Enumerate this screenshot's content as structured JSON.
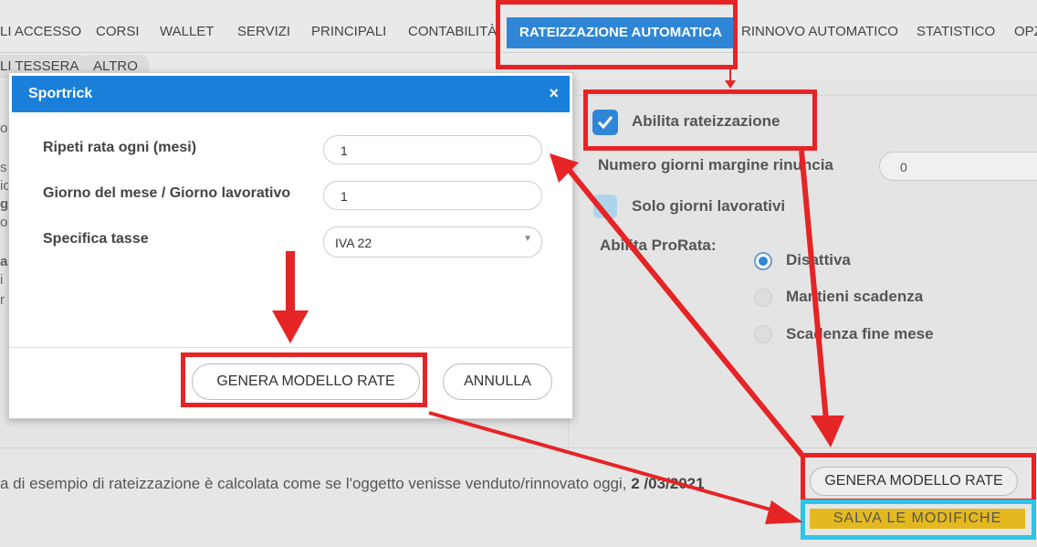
{
  "tabs_row1": [
    "LI ACCESSO",
    "CORSI",
    "WALLET",
    "SERVIZI",
    "PRINCIPALI",
    "CONTABILITÀ",
    "RATEIZZAZIONE AUTOMATICA",
    "RINNOVO AUTOMATICO",
    "STATISTICO",
    "OPZ"
  ],
  "tabs_row2": [
    "LI TESSERA",
    "ALTRO"
  ],
  "right_panel": {
    "abilita_rateizzazione": "Abilita rateizzazione",
    "numero_giorni_label": "Numero giorni margine rinuncia",
    "numero_giorni_value": "0",
    "solo_giorni": "Solo giorni lavorativi",
    "prorata_label": "Abilita ProRata:",
    "radio": [
      "Disattiva",
      "Mantieni scadenza",
      "Scadenza fine mese"
    ]
  },
  "modal": {
    "title": "Sportrick",
    "close": "×",
    "ripeti_label": "Ripeti rata ogni (mesi)",
    "ripeti_value": "1",
    "giorno_label": "Giorno del mese / Giorno lavorativo",
    "giorno_value": "1",
    "tasse_label": "Specifica tasse",
    "tasse_value": "IVA 22",
    "genera_button": "GENERA MODELLO RATE",
    "annulla_button": "ANNULLA"
  },
  "bottom": {
    "note_text": "a di esempio di rateizzazione è calcolata come se l'oggetto venisse venduto/rinnovato oggi,",
    "note_date": "2 /03/2021",
    "genera_button": "GENERA MODELLO RATE",
    "salva_button": "SALVA LE MODIFICHE"
  },
  "colors": {
    "accent": "#2f86d6",
    "annotation": "#e52426",
    "highlight": "#2fc4e6",
    "save": "#e4b920"
  }
}
